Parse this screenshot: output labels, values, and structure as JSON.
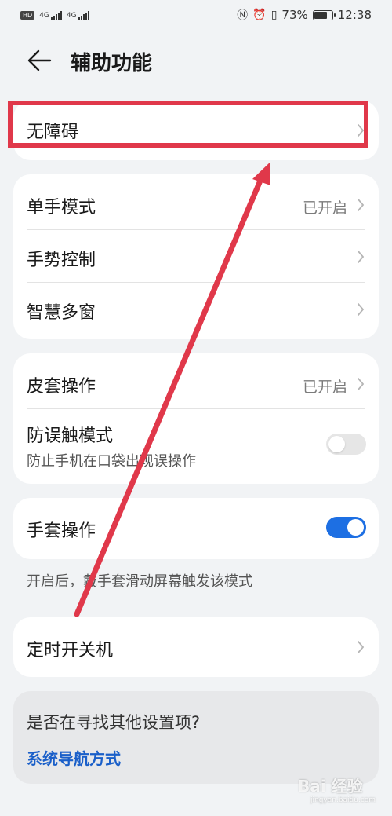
{
  "status_bar": {
    "left_tag": "HD",
    "sig1": "4G",
    "sig2": "4G",
    "battery_pct": "73%",
    "time": "12:38",
    "icons": [
      "nfc-icon",
      "alarm-icon",
      "vibrate-icon",
      "battery-icon"
    ]
  },
  "header": {
    "back_icon": "arrow-left-icon",
    "title": "辅助功能"
  },
  "card1": {
    "items": [
      {
        "label": "无障碍"
      }
    ]
  },
  "card2": {
    "items": [
      {
        "label": "单手模式",
        "value": "已开启"
      },
      {
        "label": "手势控制"
      },
      {
        "label": "智慧多窗"
      }
    ]
  },
  "card3": {
    "items": [
      {
        "label": "皮套操作",
        "value": "已开启"
      },
      {
        "label": "防误触模式",
        "sub": "防止手机在口袋出现误操作",
        "toggle": "off"
      }
    ]
  },
  "card4": {
    "items": [
      {
        "label": "手套操作",
        "toggle": "on"
      }
    ],
    "note": "开启后，戴手套滑动屏幕触发该模式"
  },
  "card5": {
    "items": [
      {
        "label": "定时开关机"
      }
    ]
  },
  "suggest": {
    "question": "是否在寻找其他设置项?",
    "link": "系统导航方式"
  },
  "watermark": {
    "text": "Bai 经验",
    "sub": "jingyan.baidu.com"
  },
  "colors": {
    "accent": "#1d6fe3",
    "link": "#1a5fc9",
    "annotation": "#e0384a",
    "background": "#f1f3f5",
    "card": "#ffffff"
  }
}
